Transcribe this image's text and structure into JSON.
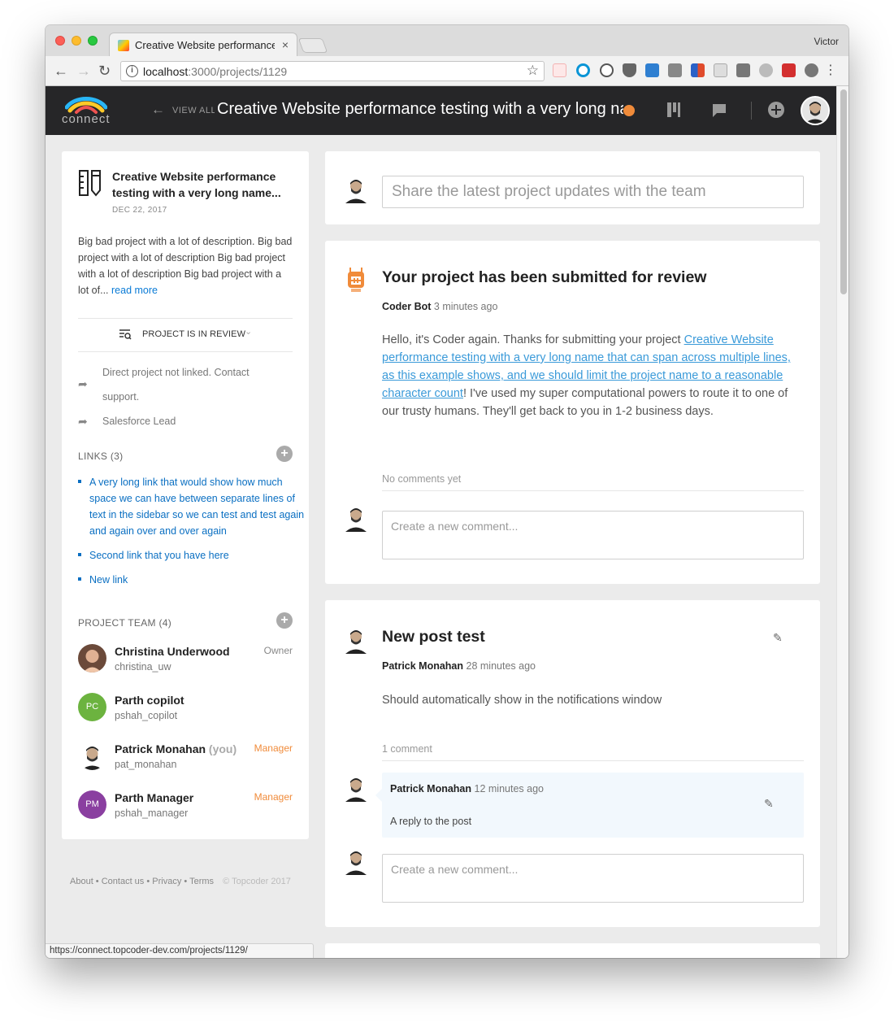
{
  "browser": {
    "tab_title": "Creative Website performance testing with a very long name...",
    "tab_close": "×",
    "user": "Victor",
    "url_host": "localhost",
    "url_path": ":3000/projects/1129",
    "status_url": "https://connect.topcoder-dev.com/projects/1129/"
  },
  "header": {
    "logo_text": "connect",
    "view_all": "VIEW ALL PROJECTS",
    "title": "Creative Website performance testing with a very long name..."
  },
  "sidebar": {
    "title": "Creative Website performance testing with a very long name...",
    "date": "DEC 22, 2017",
    "description": "Big bad project with a lot of description. Big bad project with a lot of description Big bad project with a lot of description Big bad project with a lot of... ",
    "read_more": "read more",
    "status": "PROJECT IS IN REVIEW",
    "direct_link": "Direct project not linked. Contact support.",
    "salesforce": "Salesforce Lead",
    "links_title": "LINKS (3)",
    "links": [
      {
        "label": "A very long link that would show how much space we can have between separate lines of text in the sidebar so we can test and test again and again over and over again"
      },
      {
        "label": "Second link that you have here"
      },
      {
        "label": "New link"
      }
    ],
    "team_title": "PROJECT TEAM (4)",
    "team": [
      {
        "name": "Christina Underwood",
        "you": "",
        "handle": "christina_uw",
        "role": "Owner"
      },
      {
        "name": "Parth copilot",
        "you": "",
        "handle": "pshah_copilot",
        "role": "",
        "initials": "PC"
      },
      {
        "name": "Patrick Monahan",
        "you": "(you)",
        "handle": "pat_monahan",
        "role": "Manager"
      },
      {
        "name": "Parth Manager",
        "you": "",
        "handle": "pshah_manager",
        "role": "Manager",
        "initials": "PM"
      }
    ]
  },
  "footer": {
    "about": "About",
    "contact": "Contact us",
    "privacy": "Privacy",
    "terms": "Terms",
    "copyright": "© Topcoder 2017"
  },
  "feed": {
    "share_placeholder": "Share the latest project updates with the team",
    "posts": [
      {
        "title": "Your project has been submitted for review",
        "author": "Coder Bot",
        "time": " 3 minutes ago",
        "body_pre": "Hello, it's Coder again. Thanks for submitting your project ",
        "body_link": "Creative Website performance testing with a very long name that can span across multiple lines, as this example shows, and we should limit the project name to a reasonable character count",
        "body_post": "! I've used my super computational powers to route it to one of our trusty humans. They'll get back to you in 1-2 business days.",
        "comment_count": "No comments yet",
        "comment_placeholder": "Create a new comment..."
      },
      {
        "title": "New post test",
        "author": "Patrick Monahan",
        "time": " 28 minutes ago",
        "body": "Should automatically show in the notifications window",
        "comment_count": "1 comment",
        "reply_author": "Patrick Monahan",
        "reply_time": " 12 minutes ago",
        "reply_text": "A reply to the post",
        "comment_placeholder": "Create a new comment..."
      }
    ]
  },
  "colors": {
    "header_bg": "#262628",
    "link": "#0a6fc2",
    "manager": "#f08b3a",
    "copilot_avatar": "#6cb33f",
    "manager_avatar": "#8a3fa0"
  }
}
